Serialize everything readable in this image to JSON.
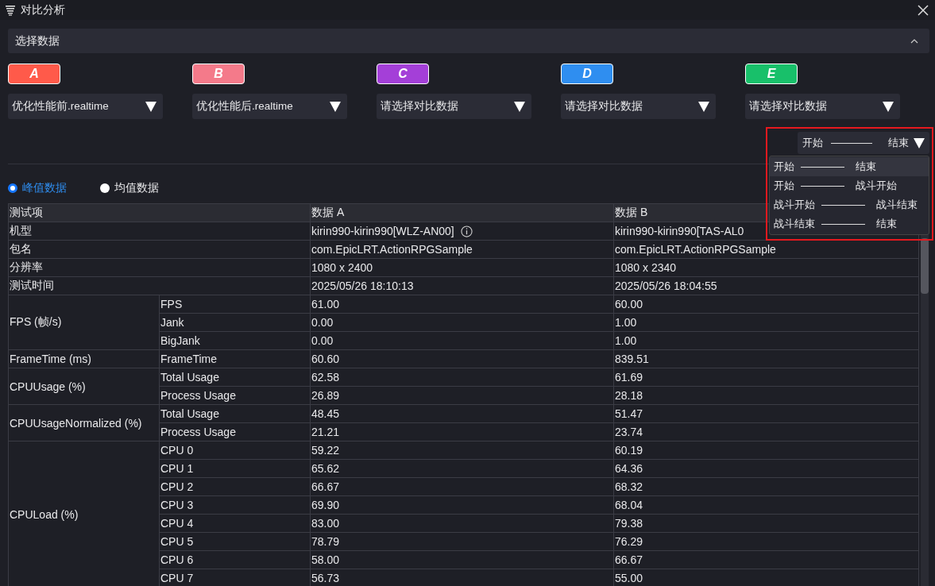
{
  "window": {
    "title": "对比分析"
  },
  "section": {
    "title": "选择数据",
    "expanded": true
  },
  "datasets": [
    {
      "badge": "A",
      "color": "#ff5a4a",
      "value": "优化性能前.realtime"
    },
    {
      "badge": "B",
      "color": "#f47a8a",
      "value": "优化性能后.realtime"
    },
    {
      "badge": "C",
      "color": "#a43fd8",
      "value": "请选择对比数据"
    },
    {
      "badge": "D",
      "color": "#2f8ef0",
      "value": "请选择对比数据"
    },
    {
      "badge": "E",
      "color": "#18c06a",
      "value": "请选择对比数据"
    }
  ],
  "range_select": {
    "start": "开始",
    "end": "结束",
    "expanded": true,
    "options": [
      {
        "start": "开始",
        "end": "结束",
        "selected": true
      },
      {
        "start": "开始",
        "end": "战斗开始",
        "selected": false
      },
      {
        "start": "战斗开始",
        "end": "战斗结束",
        "selected": false
      },
      {
        "start": "战斗结束",
        "end": "结束",
        "selected": false
      }
    ]
  },
  "modes": [
    {
      "label": "峰值数据",
      "selected": true
    },
    {
      "label": "均值数据",
      "selected": false
    }
  ],
  "table": {
    "columns": [
      "测试项",
      "数据 A",
      "数据 B"
    ],
    "rows": [
      {
        "kind": "single",
        "label": "机型",
        "values": [
          "kirin990-kirin990[WLZ-AN00]",
          "kirin990-kirin990[TAS-AL0"
        ],
        "info": true
      },
      {
        "kind": "single",
        "label": "包名",
        "values": [
          "com.EpicLRT.ActionRPGSample",
          "com.EpicLRT.ActionRPGSample"
        ]
      },
      {
        "kind": "single",
        "label": "分辨率",
        "values": [
          "1080 x 2400",
          "1080 x 2340"
        ]
      },
      {
        "kind": "single",
        "label": "测试时间",
        "values": [
          "2025/05/26 18:10:13",
          "2025/05/26 18:04:55"
        ]
      },
      {
        "kind": "group",
        "label": "FPS (帧/s)",
        "children": [
          {
            "label": "FPS",
            "values": [
              "61.00",
              "60.00"
            ]
          },
          {
            "label": "Jank",
            "values": [
              "0.00",
              "1.00"
            ]
          },
          {
            "label": "BigJank",
            "values": [
              "0.00",
              "1.00"
            ]
          }
        ]
      },
      {
        "kind": "group",
        "label": "FrameTime (ms)",
        "children": [
          {
            "label": "FrameTime",
            "values": [
              "60.60",
              "839.51"
            ]
          }
        ]
      },
      {
        "kind": "group",
        "label": "CPUUsage (%)",
        "children": [
          {
            "label": "Total Usage",
            "values": [
              "62.58",
              "61.69"
            ]
          },
          {
            "label": "Process Usage",
            "values": [
              "26.89",
              "28.18"
            ]
          }
        ]
      },
      {
        "kind": "group",
        "label": "CPUUsageNormalized (%)",
        "children": [
          {
            "label": "Total Usage",
            "values": [
              "48.45",
              "51.47"
            ]
          },
          {
            "label": "Process Usage",
            "values": [
              "21.21",
              "23.74"
            ]
          }
        ]
      },
      {
        "kind": "group",
        "label": "CPULoad (%)",
        "children": [
          {
            "label": "CPU 0",
            "values": [
              "59.22",
              "60.19"
            ]
          },
          {
            "label": "CPU 1",
            "values": [
              "65.62",
              "64.36"
            ]
          },
          {
            "label": "CPU 2",
            "values": [
              "66.67",
              "68.32"
            ]
          },
          {
            "label": "CPU 3",
            "values": [
              "69.90",
              "68.04"
            ]
          },
          {
            "label": "CPU 4",
            "values": [
              "83.00",
              "79.38"
            ]
          },
          {
            "label": "CPU 5",
            "values": [
              "78.79",
              "76.29"
            ]
          },
          {
            "label": "CPU 6",
            "values": [
              "58.00",
              "66.67"
            ]
          },
          {
            "label": "CPU 7",
            "values": [
              "56.73",
              "55.00"
            ]
          }
        ]
      }
    ]
  }
}
